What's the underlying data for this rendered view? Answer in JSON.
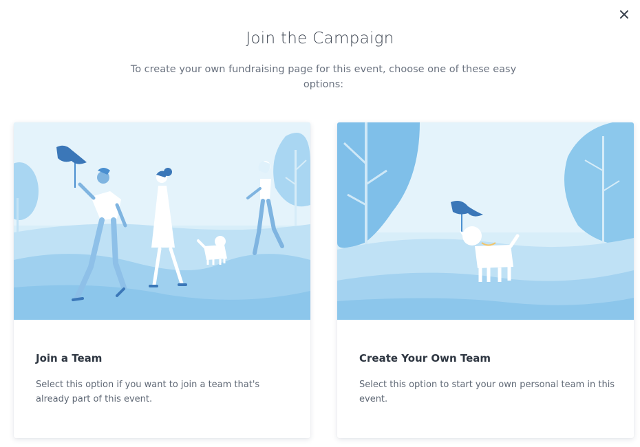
{
  "modal": {
    "title": "Join the Campaign",
    "subtitle": "To create your own fundraising page for this event, choose one of these easy options:",
    "close_icon": "close-icon"
  },
  "options": [
    {
      "title": "Join a Team",
      "description": "Select this option if you want to join a team that's already part of this event.",
      "illustration": "people-walking-with-flag-and-dog"
    },
    {
      "title": "Create Your Own Team",
      "description": "Select this option to start your own personal team in this event.",
      "illustration": "dog-holding-flag"
    }
  ],
  "colors": {
    "sky": "#cfe9f8",
    "accent": "#3f8fd6",
    "text_dark": "#2f3742",
    "text_muted": "#5f6875"
  }
}
